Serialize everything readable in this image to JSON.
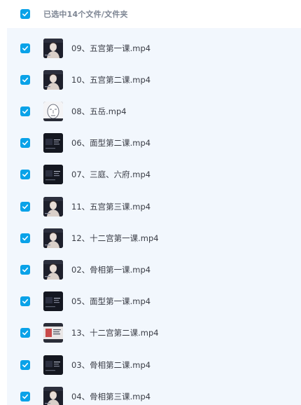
{
  "header": {
    "title": "已选中14个文件/文件夹",
    "checkbox_color": "#0aa2e8"
  },
  "files": [
    {
      "name": "09、五宫第一课.mp4",
      "thumb": "portrait-dark"
    },
    {
      "name": "10、五宫第二课.mp4",
      "thumb": "portrait-dark"
    },
    {
      "name": "08、五岳.mp4",
      "thumb": "face-diagram"
    },
    {
      "name": "06、面型第二课.mp4",
      "thumb": "slide-dark"
    },
    {
      "name": "07、三庭、六府.mp4",
      "thumb": "slide-dark"
    },
    {
      "name": "11、五宫第三课.mp4",
      "thumb": "portrait-dark"
    },
    {
      "name": "12、十二宫第一课.mp4",
      "thumb": "portrait-dark"
    },
    {
      "name": "02、骨相第一课.mp4",
      "thumb": "portrait-dark"
    },
    {
      "name": "05、面型第一课.mp4",
      "thumb": "slide-dark"
    },
    {
      "name": "13、十二宫第二课.mp4",
      "thumb": "slide-light"
    },
    {
      "name": "03、骨相第二课.mp4",
      "thumb": "slide-dark"
    },
    {
      "name": "04、骨相第三课.mp4",
      "thumb": "portrait-dark"
    }
  ]
}
